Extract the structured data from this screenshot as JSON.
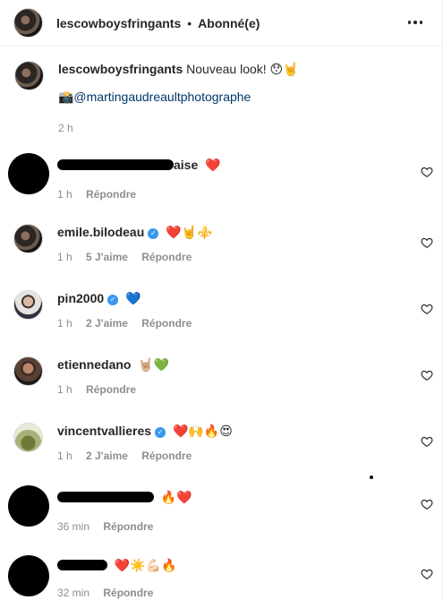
{
  "header": {
    "username": "lescowboysfringants",
    "separator": "•",
    "follow_status": "Abonné(e)",
    "more_icon": "three-dots-icon"
  },
  "caption": {
    "username": "lescowboysfringants",
    "text": "Nouveau look! 😯🤘",
    "link": "📸@martingaudreaultphotographe",
    "time": "2 h"
  },
  "comments": [
    {
      "username": "",
      "redacted": true,
      "visible_fragment": "aise",
      "text": "❤️",
      "time": "1 h",
      "likes": "",
      "reply": "Répondre",
      "avatar": "black"
    },
    {
      "username": "emile.bilodeau",
      "verified": true,
      "text": "❤️🤘⚜️",
      "time": "1 h",
      "likes": "5 J'aime",
      "reply": "Répondre",
      "avatar": "photo"
    },
    {
      "username": "pin2000",
      "verified": true,
      "text": "💙",
      "time": "1 h",
      "likes": "2 J'aime",
      "reply": "Répondre",
      "avatar": "photo"
    },
    {
      "username": "etiennedano",
      "verified": false,
      "text": "🤘🏼💚",
      "time": "1 h",
      "likes": "",
      "reply": "Répondre",
      "avatar": "photo"
    },
    {
      "username": "vincentvallieres",
      "verified": true,
      "text": "❤️🙌🔥😍",
      "time": "1 h",
      "likes": "2 J'aime",
      "reply": "Répondre",
      "avatar": "photo"
    },
    {
      "username": "",
      "redacted": true,
      "text": "🔥❤️",
      "time": "36 min",
      "likes": "",
      "reply": "Répondre",
      "avatar": "black"
    },
    {
      "username": "",
      "redacted": true,
      "text": "❤️☀️💪🏻🔥",
      "time": "32 min",
      "likes": "",
      "reply": "Répondre",
      "avatar": "black"
    }
  ],
  "icons": {
    "like": "heart-outline-icon",
    "verified": "verified-badge-icon"
  },
  "colors": {
    "text": "#262626",
    "muted": "#8e8e8e",
    "link": "#00376b",
    "verified": "#3897f0",
    "divider": "#efefef"
  }
}
